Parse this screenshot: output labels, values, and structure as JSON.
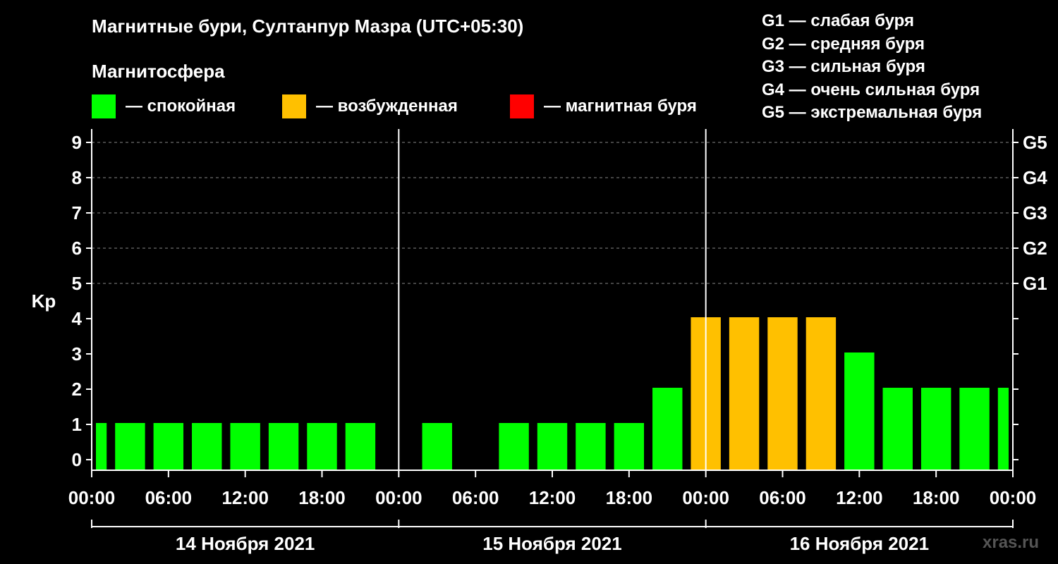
{
  "title": "Магнитные бури, Султанпур Мазра (UTC+05:30)",
  "subtitle": "Магнитосфера",
  "legend": [
    {
      "color": "#00ff00",
      "label": "— спокойная"
    },
    {
      "color": "#ffc000",
      "label": "— возбужденная"
    },
    {
      "color": "#ff0000",
      "label": "— магнитная буря"
    }
  ],
  "storm_scale": [
    "G1 — слабая буря",
    "G2 — средняя буря",
    "G3 — сильная буря",
    "G4 — очень сильная буря",
    "G5 — экстремальная буря"
  ],
  "watermark": "xras.ru",
  "chart_data": {
    "type": "bar",
    "ylabel": "Kp",
    "ylim": [
      0,
      9
    ],
    "yticks": [
      "0",
      "1",
      "2",
      "3",
      "4",
      "5",
      "6",
      "7",
      "8",
      "9"
    ],
    "right_ticks": [
      {
        "value": 5,
        "label": "G1"
      },
      {
        "value": 6,
        "label": "G2"
      },
      {
        "value": 7,
        "label": "G3"
      },
      {
        "value": 8,
        "label": "G4"
      },
      {
        "value": 9,
        "label": "G5"
      }
    ],
    "xticks": [
      "00:00",
      "06:00",
      "12:00",
      "18:00",
      "00:00",
      "06:00",
      "12:00",
      "18:00",
      "00:00",
      "06:00",
      "12:00",
      "18:00",
      "00:00"
    ],
    "days": [
      "14 Ноября 2021",
      "15 Ноября 2021",
      "16 Ноября 2021"
    ],
    "grid": true,
    "bars": [
      {
        "start_hour": 0,
        "end_hour": 1.5,
        "kp": 1,
        "color": "#00ff00"
      },
      {
        "start_hour": 1.5,
        "end_hour": 4.5,
        "kp": 1,
        "color": "#00ff00"
      },
      {
        "start_hour": 4.5,
        "end_hour": 7.5,
        "kp": 1,
        "color": "#00ff00"
      },
      {
        "start_hour": 7.5,
        "end_hour": 10.5,
        "kp": 1,
        "color": "#00ff00"
      },
      {
        "start_hour": 10.5,
        "end_hour": 13.5,
        "kp": 1,
        "color": "#00ff00"
      },
      {
        "start_hour": 13.5,
        "end_hour": 16.5,
        "kp": 1,
        "color": "#00ff00"
      },
      {
        "start_hour": 16.5,
        "end_hour": 19.5,
        "kp": 1,
        "color": "#00ff00"
      },
      {
        "start_hour": 19.5,
        "end_hour": 22.5,
        "kp": 1,
        "color": "#00ff00"
      },
      {
        "start_hour": 25.5,
        "end_hour": 28.5,
        "kp": 1,
        "color": "#00ff00"
      },
      {
        "start_hour": 31.5,
        "end_hour": 34.5,
        "kp": 1,
        "color": "#00ff00"
      },
      {
        "start_hour": 34.5,
        "end_hour": 37.5,
        "kp": 1,
        "color": "#00ff00"
      },
      {
        "start_hour": 37.5,
        "end_hour": 40.5,
        "kp": 1,
        "color": "#00ff00"
      },
      {
        "start_hour": 40.5,
        "end_hour": 43.5,
        "kp": 1,
        "color": "#00ff00"
      },
      {
        "start_hour": 43.5,
        "end_hour": 46.5,
        "kp": 2,
        "color": "#00ff00"
      },
      {
        "start_hour": 46.5,
        "end_hour": 49.5,
        "kp": 4,
        "color": "#ffc000"
      },
      {
        "start_hour": 49.5,
        "end_hour": 52.5,
        "kp": 4,
        "color": "#ffc000"
      },
      {
        "start_hour": 52.5,
        "end_hour": 55.5,
        "kp": 4,
        "color": "#ffc000"
      },
      {
        "start_hour": 55.5,
        "end_hour": 58.5,
        "kp": 4,
        "color": "#ffc000"
      },
      {
        "start_hour": 58.5,
        "end_hour": 61.5,
        "kp": 3,
        "color": "#00ff00"
      },
      {
        "start_hour": 61.5,
        "end_hour": 64.5,
        "kp": 2,
        "color": "#00ff00"
      },
      {
        "start_hour": 64.5,
        "end_hour": 67.5,
        "kp": 2,
        "color": "#00ff00"
      },
      {
        "start_hour": 67.5,
        "end_hour": 70.5,
        "kp": 2,
        "color": "#00ff00"
      },
      {
        "start_hour": 70.5,
        "end_hour": 72,
        "kp": 2,
        "color": "#00ff00"
      }
    ]
  }
}
